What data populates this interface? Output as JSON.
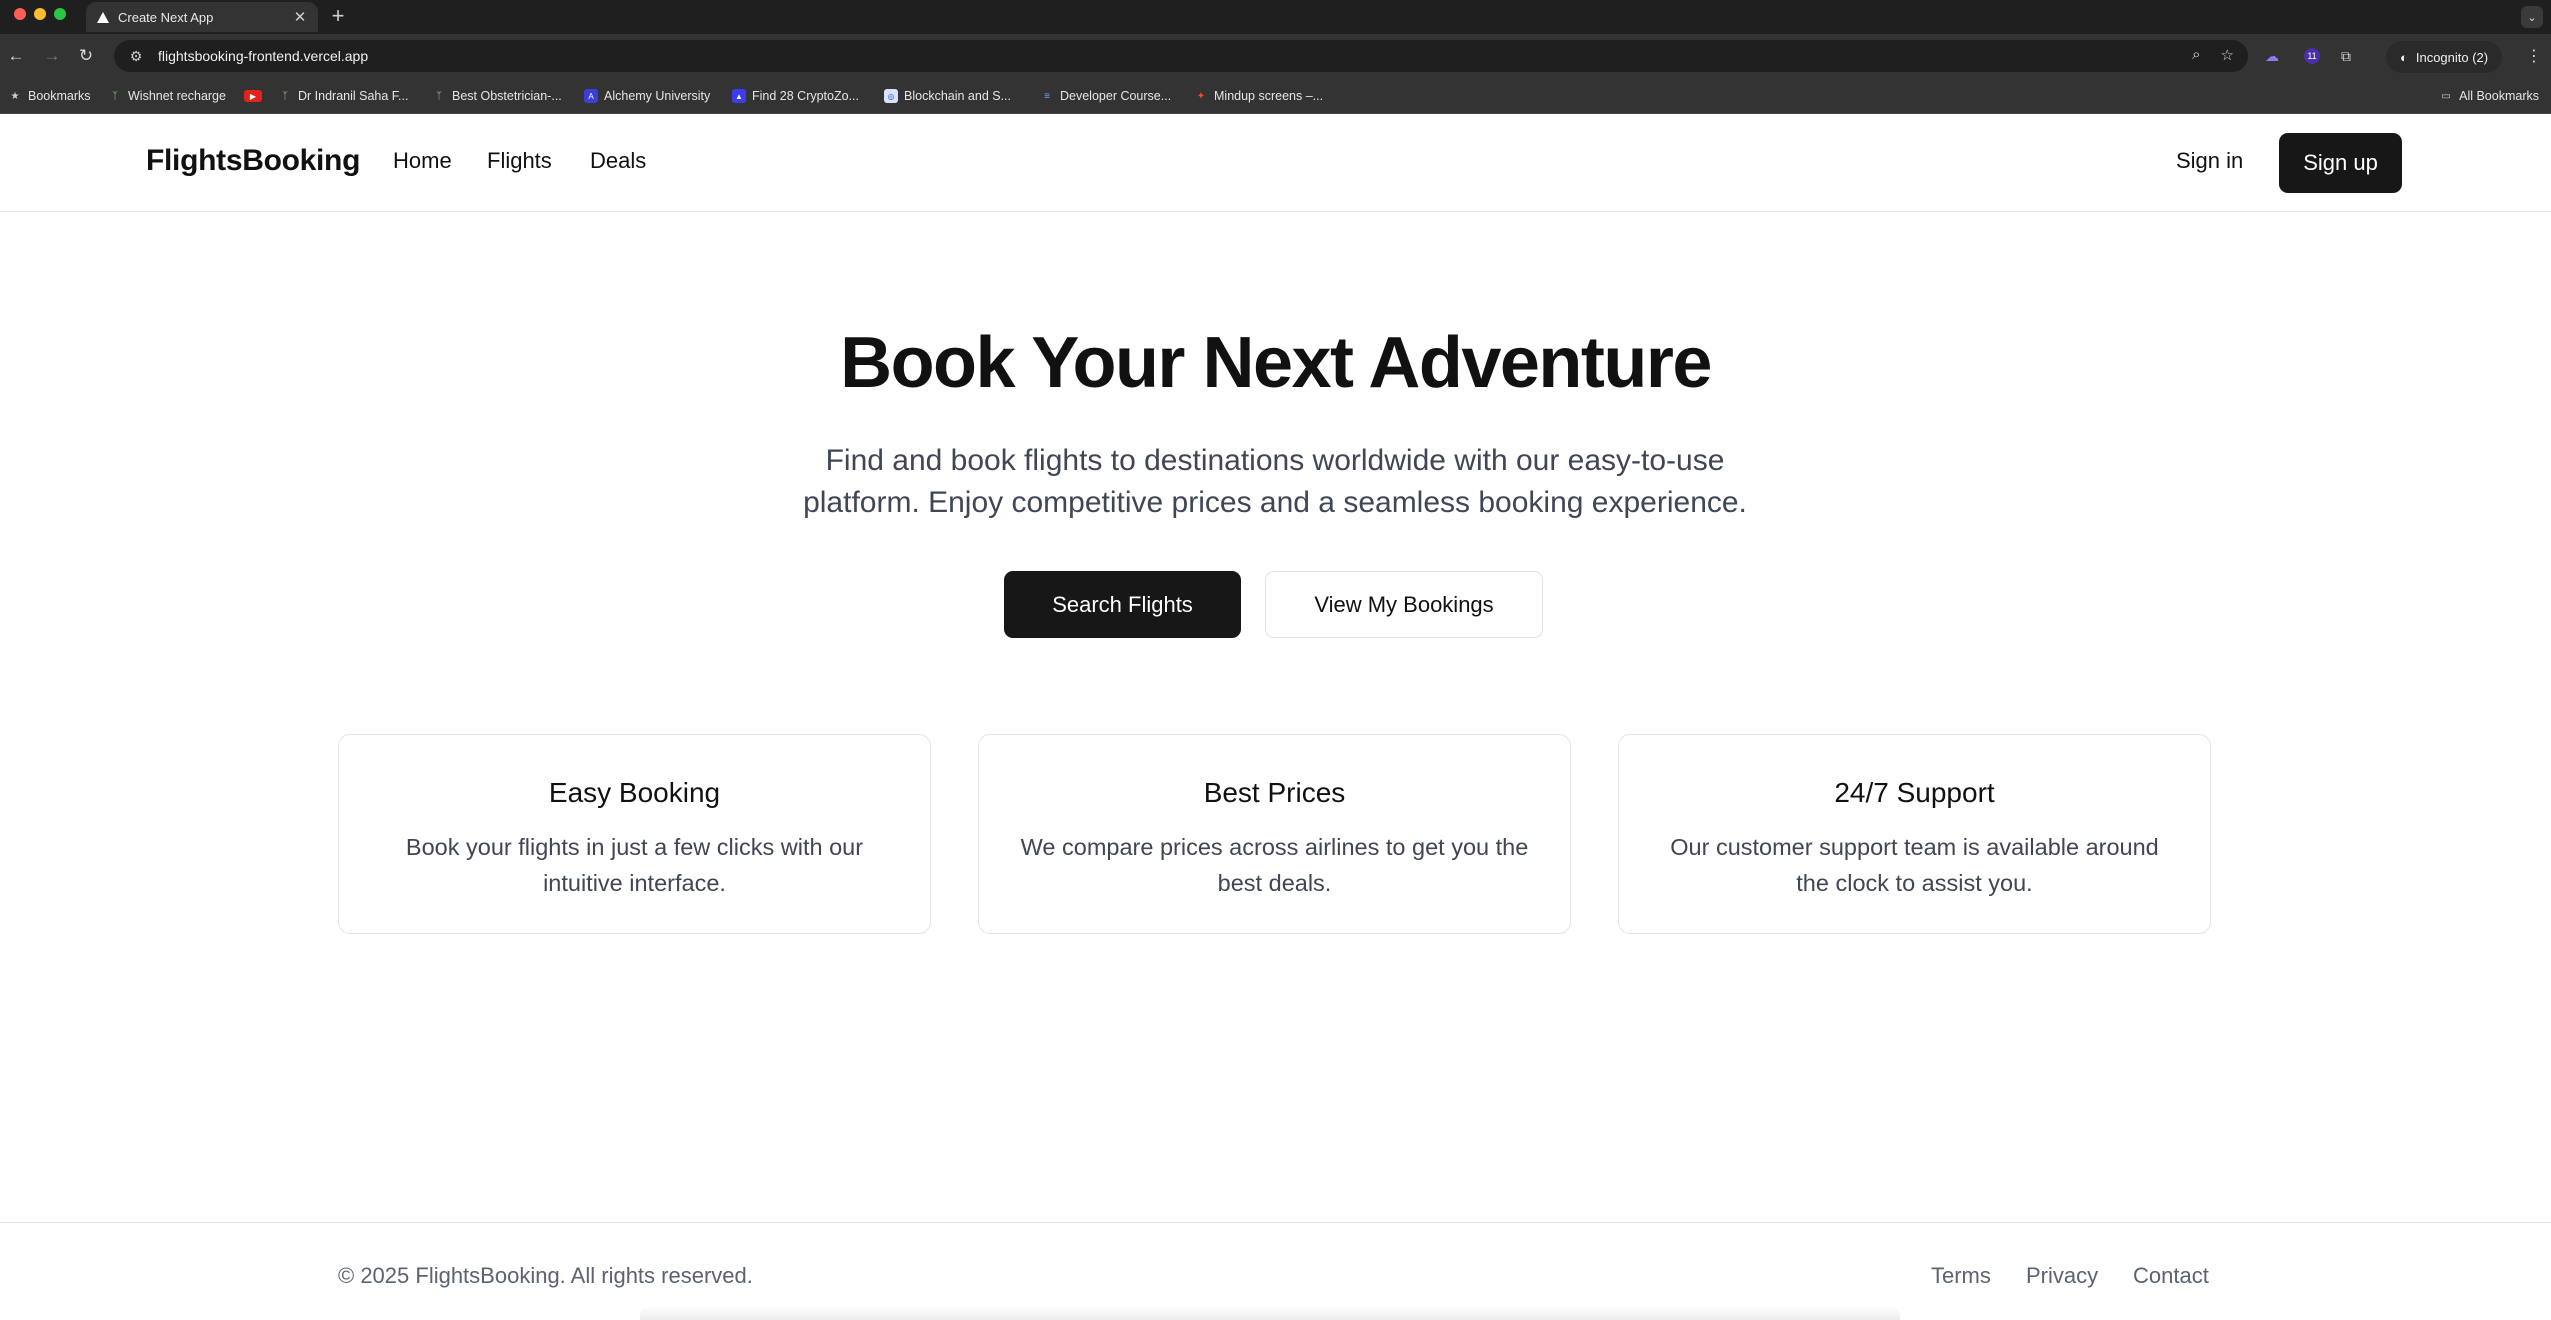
{
  "browser": {
    "tab_title": "Create Next App",
    "url": "flightsbooking-frontend.vercel.app",
    "incognito_label": "Incognito (2)",
    "extension_badge": "11",
    "bookmarks": [
      {
        "label": "Bookmarks",
        "icon": "star-icon"
      },
      {
        "label": "Wishnet recharge",
        "icon": "site-icon"
      },
      {
        "label": "",
        "icon": "youtube-icon"
      },
      {
        "label": "Dr Indranil Saha F...",
        "icon": "site-icon"
      },
      {
        "label": "Best Obstetrician-...",
        "icon": "site-icon"
      },
      {
        "label": "Alchemy University",
        "icon": "alchemy-icon"
      },
      {
        "label": "Find 28 CryptoZo...",
        "icon": "triangle-icon"
      },
      {
        "label": "Blockchain and S...",
        "icon": "site-icon"
      },
      {
        "label": "Developer Course...",
        "icon": "stack-icon"
      },
      {
        "label": "Mindup screens –...",
        "icon": "figma-icon"
      }
    ],
    "all_bookmarks": "All Bookmarks"
  },
  "header": {
    "logo": "FlightsBooking",
    "nav": [
      "Home",
      "Flights",
      "Deals"
    ],
    "sign_in": "Sign in",
    "sign_up": "Sign up"
  },
  "hero": {
    "title": "Book Your Next Adventure",
    "subtitle": "Find and book flights to destinations worldwide with our easy-to-use platform. Enjoy competitive prices and a seamless booking experience.",
    "primary_button": "Search Flights",
    "secondary_button": "View My Bookings"
  },
  "features": [
    {
      "title": "Easy Booking",
      "text": "Book your flights in just a few clicks with our intuitive interface."
    },
    {
      "title": "Best Prices",
      "text": "We compare prices across airlines to get you the best deals."
    },
    {
      "title": "24/7 Support",
      "text": "Our customer support team is available around the clock to assist you."
    }
  ],
  "footer": {
    "copyright": "© 2025 FlightsBooking. All rights reserved.",
    "links": [
      "Terms",
      "Privacy",
      "Contact"
    ]
  },
  "colors": {
    "primary_button_bg": "#171717",
    "body_text": "#3f4654",
    "border": "#e5e5e5"
  }
}
